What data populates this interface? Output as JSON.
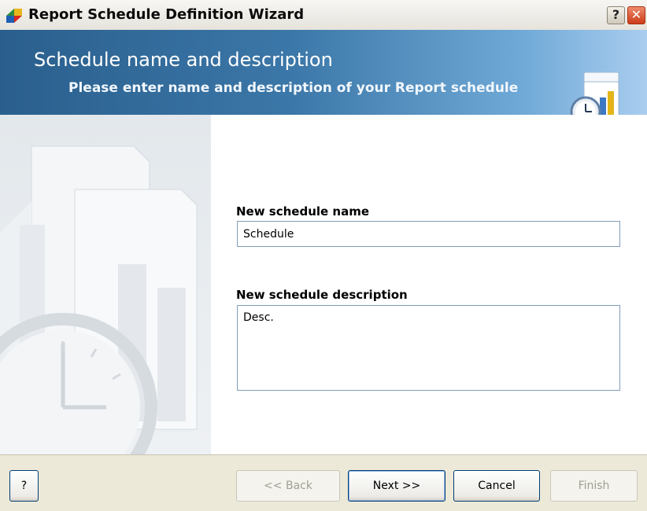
{
  "window": {
    "title": "Report Schedule Definition Wizard",
    "help_glyph": "?",
    "close_glyph": "✕"
  },
  "header": {
    "title": "Schedule name and description",
    "subtitle": "Please enter name and description of your Report schedule",
    "icon": "report-clock-chart-icon"
  },
  "form": {
    "name_label": "New schedule name",
    "name_value": "Schedule",
    "description_label": "New schedule description",
    "description_value": "Desc."
  },
  "buttons": {
    "help": "?",
    "back": "<< Back",
    "next": "Next >>",
    "cancel": "Cancel",
    "finish": "Finish"
  },
  "colors": {
    "header_dark": "#2a5f8d",
    "header_light": "#a9cdef",
    "dialog_face": "#ece9d8",
    "close_red": "#cc3b18"
  }
}
